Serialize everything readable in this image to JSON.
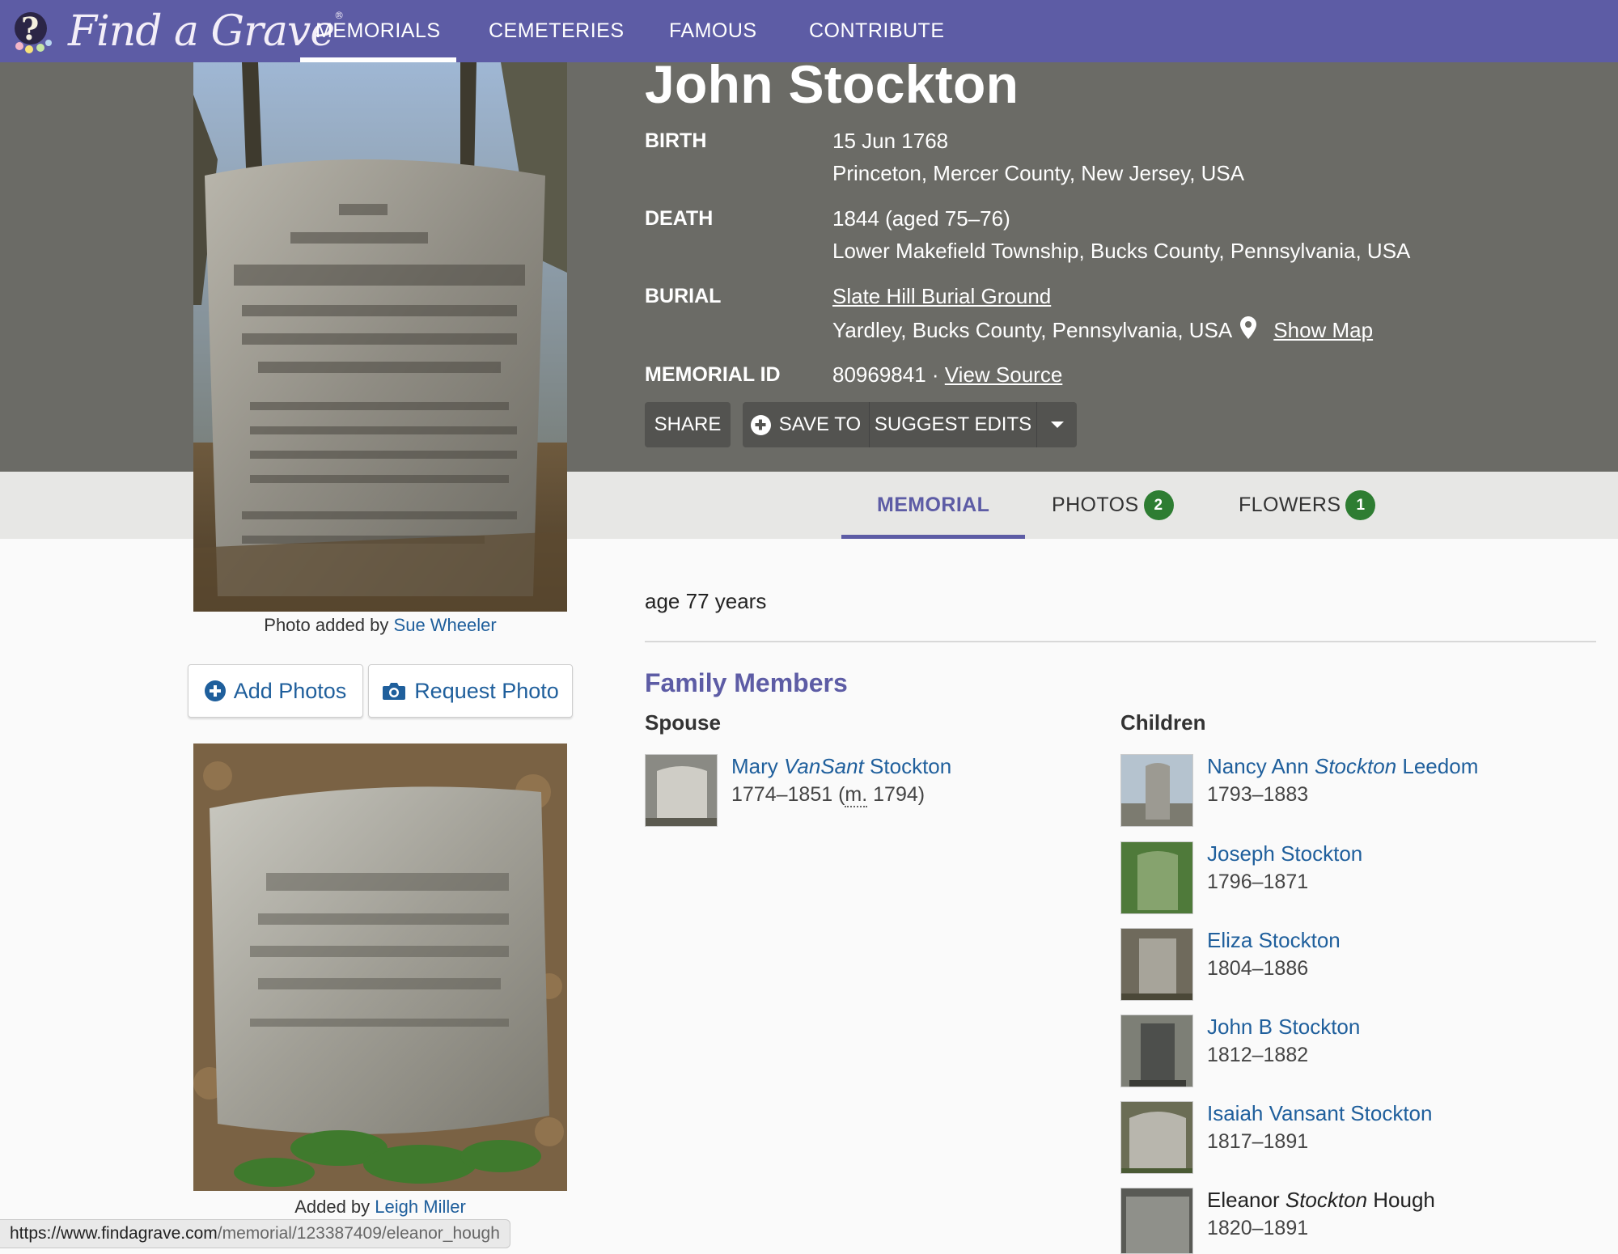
{
  "nav": {
    "logo_text": "Find a Grave",
    "logo_mark": "®",
    "items": [
      "MEMORIALS",
      "CEMETERIES",
      "FAMOUS",
      "CONTRIBUTE"
    ]
  },
  "memorial": {
    "name": "John Stockton",
    "birth_label": "BIRTH",
    "birth_date": "15 Jun 1768",
    "birth_place": "Princeton, Mercer County, New Jersey, USA",
    "death_label": "DEATH",
    "death_date": "1844 (aged 75–76)",
    "death_place": "Lower Makefield Township, Bucks County, Pennsylvania, USA",
    "burial_label": "BURIAL",
    "burial_cemetery": "Slate Hill Burial Ground",
    "burial_place": "Yardley, Bucks County, Pennsylvania, USA",
    "show_map": "Show Map",
    "id_label": "MEMORIAL ID",
    "id_value": "80969841 ·",
    "view_source": "View Source"
  },
  "actions": {
    "share": "SHARE",
    "save_to": "SAVE TO",
    "suggest_edits": "SUGGEST EDITS"
  },
  "tabs": {
    "memorial": "MEMORIAL",
    "photos": "PHOTOS",
    "photos_count": "2",
    "flowers": "FLOWERS",
    "flowers_count": "1"
  },
  "photos": {
    "main_caption_prefix": "Photo added by",
    "main_caption_user": "Sue Wheeler",
    "add_photos": "Add Photos",
    "request_photo": "Request Photo",
    "second_caption_prefix": "Added by",
    "second_caption_user": "Leigh Miller"
  },
  "bio": "age 77 years",
  "family": {
    "title": "Family Members",
    "spouse_label": "Spouse",
    "children_label": "Children",
    "spouse": {
      "first": "Mary",
      "maiden": "VanSant",
      "last": "Stockton",
      "dates": "1774–1851 (",
      "married_abbr": "m.",
      "married_year": " 1794)"
    },
    "children": [
      {
        "first": "Nancy Ann",
        "maiden": "Stockton",
        "last": "Leedom",
        "dates": "1793–1883"
      },
      {
        "first": "Joseph Stockton",
        "maiden": "",
        "last": "",
        "dates": "1796–1871"
      },
      {
        "first": "Eliza Stockton",
        "maiden": "",
        "last": "",
        "dates": "1804–1886"
      },
      {
        "first": "John B Stockton",
        "maiden": "",
        "last": "",
        "dates": "1812–1882"
      },
      {
        "first": "Isaiah Vansant Stockton",
        "maiden": "",
        "last": "",
        "dates": "1817–1891"
      },
      {
        "first": "Eleanor",
        "maiden": "Stockton",
        "last": "Hough",
        "dates": "1820–1891"
      }
    ]
  },
  "statusbar": {
    "host": "https://www.findagrave.com",
    "path": "/memorial/123387409/eleanor_hough"
  },
  "colors": {
    "nav": "#5d5ca5",
    "header": "#6b6b66",
    "link": "#1f5f9c",
    "badge": "#2e7d32"
  }
}
